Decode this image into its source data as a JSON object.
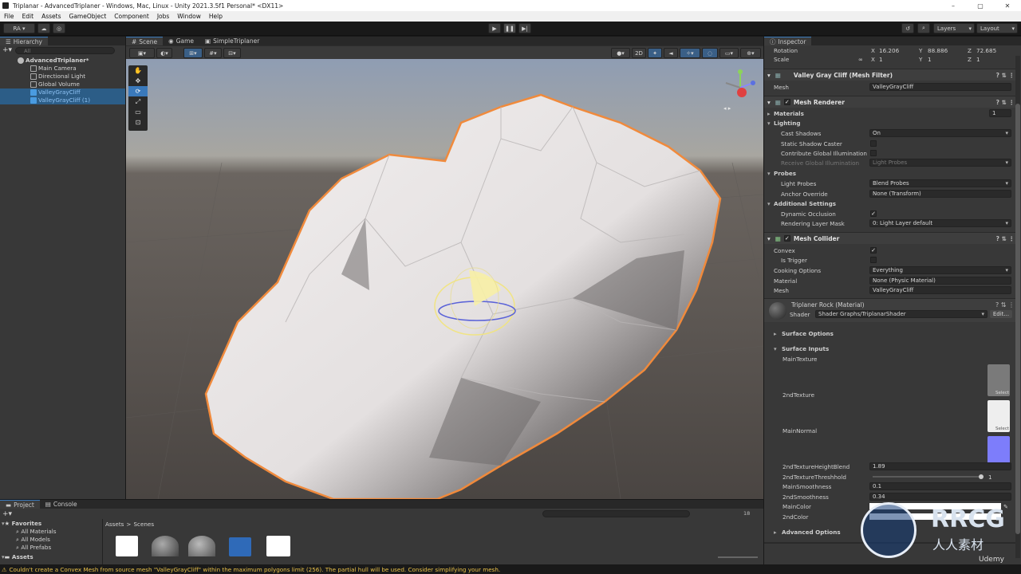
{
  "window": {
    "title": "Triplanar - AdvancedTriplaner - Windows, Mac, Linux - Unity 2021.3.5f1 Personal* <DX11>"
  },
  "menu": [
    "File",
    "Edit",
    "Assets",
    "GameObject",
    "Component",
    "Jobs",
    "Window",
    "Help"
  ],
  "toolbar": {
    "account": "RA ▾",
    "layers": "Layers",
    "layout": "Layout"
  },
  "hierarchy": {
    "tab": "Hierarchy",
    "search_placeholder": "All",
    "scene": "AdvancedTriplaner*",
    "items": [
      {
        "label": "Main Camera",
        "selected": false
      },
      {
        "label": "Directional Light",
        "selected": false
      },
      {
        "label": "Global Volume",
        "selected": false
      },
      {
        "label": "ValleyGrayCliff",
        "selected": true
      },
      {
        "label": "ValleyGrayCliff (1)",
        "selected": true
      }
    ]
  },
  "scene": {
    "tabs": [
      "Scene",
      "Game",
      "SimpleTriplaner"
    ],
    "mode_2d": "2D"
  },
  "inspector": {
    "tab": "Inspector",
    "transform": {
      "rotation_label": "Rotation",
      "scale_label": "Scale",
      "rx": "16.206",
      "ry": "88.886",
      "rz": "72.685",
      "sx": "1",
      "sy": "1",
      "sz": "1"
    },
    "mesh_filter": {
      "title": "Valley Gray Cliff (Mesh Filter)",
      "mesh_label": "Mesh",
      "mesh_value": "ValleyGrayCliff"
    },
    "mesh_renderer": {
      "title": "Mesh Renderer",
      "materials": "Materials",
      "materials_count": "1",
      "lighting": "Lighting",
      "cast_shadows": "Cast Shadows",
      "cast_shadows_value": "On",
      "static_caster": "Static Shadow Caster",
      "contribute_gi": "Contribute Global Illumination",
      "receive_gi": "Receive Global Illumination",
      "receive_gi_value": "Light Probes",
      "probes": "Probes",
      "light_probes": "Light Probes",
      "light_probes_value": "Blend Probes",
      "anchor": "Anchor Override",
      "anchor_value": "None (Transform)",
      "additional": "Additional Settings",
      "dynamic_occlusion": "Dynamic Occlusion",
      "rendering_layer": "Rendering Layer Mask",
      "rendering_layer_value": "0: Light Layer default"
    },
    "mesh_collider": {
      "title": "Mesh Collider",
      "convex": "Convex",
      "is_trigger": "Is Trigger",
      "cooking": "Cooking Options",
      "cooking_value": "Everything",
      "material": "Material",
      "material_value": "None (Physic Material)",
      "mesh": "Mesh",
      "mesh_value": "ValleyGrayCliff"
    },
    "material": {
      "title": "Triplaner Rock (Material)",
      "shader_label": "Shader",
      "shader_value": "Shader Graphs/TriplanarShader",
      "edit": "Edit...",
      "surface_options": "Surface Options",
      "surface_inputs": "Surface Inputs",
      "main_texture": "MainTexture",
      "second_texture": "2ndTexture",
      "main_normal": "MainNormal",
      "select": "Select",
      "height_blend": "2ndTextureHeightBlend",
      "height_blend_value": "1.89",
      "threshold": "2ndTextureThreshhold",
      "threshold_value": "1",
      "main_smooth": "MainSmoothness",
      "main_smooth_value": "0.1",
      "second_smooth": "2ndSmoothness",
      "second_smooth_value": "0.34",
      "main_color": "MainColor",
      "second_color": "2ndColor",
      "advanced": "Advanced Options"
    }
  },
  "project": {
    "tabs": [
      "Project",
      "Console"
    ],
    "favorites": "Favorites",
    "fav_items": [
      "All Materials",
      "All Models",
      "All Prefabs"
    ],
    "assets": "Assets",
    "breadcrumb": [
      "Assets",
      ">",
      "Scenes"
    ],
    "hidden_count": "18"
  },
  "status": {
    "message": "Couldn't create a Convex Mesh from source mesh \"ValleyGrayCliff\" within the maximum polygons limit (256). The partial hull will be used. Consider simplifying your mesh."
  },
  "watermark": {
    "brand": "RRCG",
    "sub": "人人素材",
    "udemy": "Udemy"
  },
  "colors": {
    "selection": "#2c5d87",
    "accent": "#3a79bb",
    "outline": "#f08a3c",
    "warning": "#e9c14a"
  }
}
